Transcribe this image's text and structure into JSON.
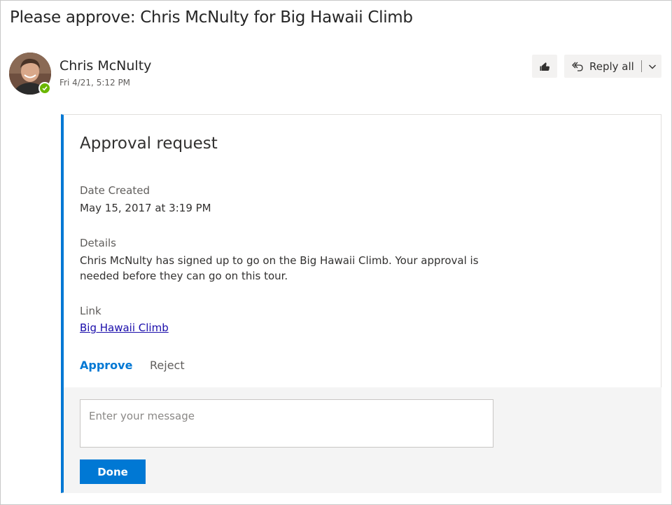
{
  "email": {
    "subject": "Please approve: Chris McNulty for Big Hawaii Climb",
    "sender": {
      "name": "Chris McNulty",
      "sent_time": "Fri 4/21, 5:12 PM",
      "avatar_icon": "person-photo-avatar",
      "presence_icon": "presence-available-checkmark",
      "presence_color": "#6bb700"
    },
    "toolbar": {
      "like_icon": "thumbs-up-icon",
      "reply_all_label": "Reply all",
      "reply_all_icon": "reply-all-icon",
      "more_icon": "chevron-down-icon"
    }
  },
  "card": {
    "accent_color": "#0078d4",
    "title": "Approval request",
    "date_created_label": "Date Created",
    "date_created_value": "May 15, 2017 at 3:19 PM",
    "details_label": "Details",
    "details_text": "Chris McNulty has signed up to go on the Big Hawaii Climb. Your approval is needed before they can go on this tour.",
    "link_label": "Link",
    "link_text": "Big Hawaii Climb",
    "actions": {
      "approve": "Approve",
      "reject": "Reject"
    },
    "compose": {
      "placeholder": "Enter your message",
      "value": "",
      "done_label": "Done"
    }
  }
}
